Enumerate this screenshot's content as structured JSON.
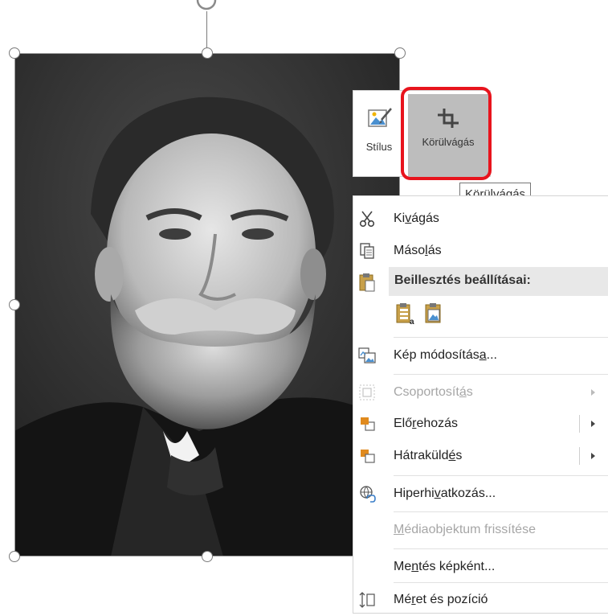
{
  "toolbar": {
    "style_label": "Stílus",
    "crop_label": "Körülvágás",
    "style_icon": "picture-style-icon",
    "crop_icon": "crop-icon"
  },
  "tooltip": {
    "text": "Körülvágás"
  },
  "menu": {
    "cut": {
      "before": "Ki",
      "accel": "v",
      "after": "ágás",
      "icon": "scissors-icon"
    },
    "copy": {
      "before": "Máso",
      "accel": "l",
      "after": "ás",
      "icon": "copy-icon"
    },
    "paste_header": {
      "label": "Beillesztés beállításai:",
      "icon": "clipboard-icon"
    },
    "paste_options": [
      "paste-keep-text-icon",
      "paste-picture-icon"
    ],
    "change_picture": {
      "before": "Kép módosítás",
      "accel": "a",
      "after": "...",
      "icon": "change-picture-icon"
    },
    "group": {
      "before": "Csoportosít",
      "accel": "á",
      "after": "s",
      "icon": "group-icon",
      "disabled": true
    },
    "bring_forward": {
      "before": "Elő",
      "accel": "r",
      "after": "ehozás",
      "icon": "bring-forward-icon"
    },
    "send_backward": {
      "before": "Hátraküld",
      "accel": "é",
      "after": "s",
      "icon": "send-backward-icon"
    },
    "hyperlink": {
      "before": "Hiperhi",
      "accel": "v",
      "after": "atkozás...",
      "icon": "hyperlink-icon"
    },
    "refresh_media": {
      "before": "",
      "accel": "M",
      "after": "édiaobjektum frissítése",
      "disabled": true
    },
    "save_as_picture": {
      "before": "Me",
      "accel": "n",
      "after": "tés képként..."
    },
    "size_position": {
      "before": "Mé",
      "accel": "r",
      "after": "et és pozíció",
      "icon": "size-position-icon"
    }
  },
  "colors": {
    "highlight": "#e8141d",
    "toolbar_active_bg": "#bdbdbd"
  }
}
